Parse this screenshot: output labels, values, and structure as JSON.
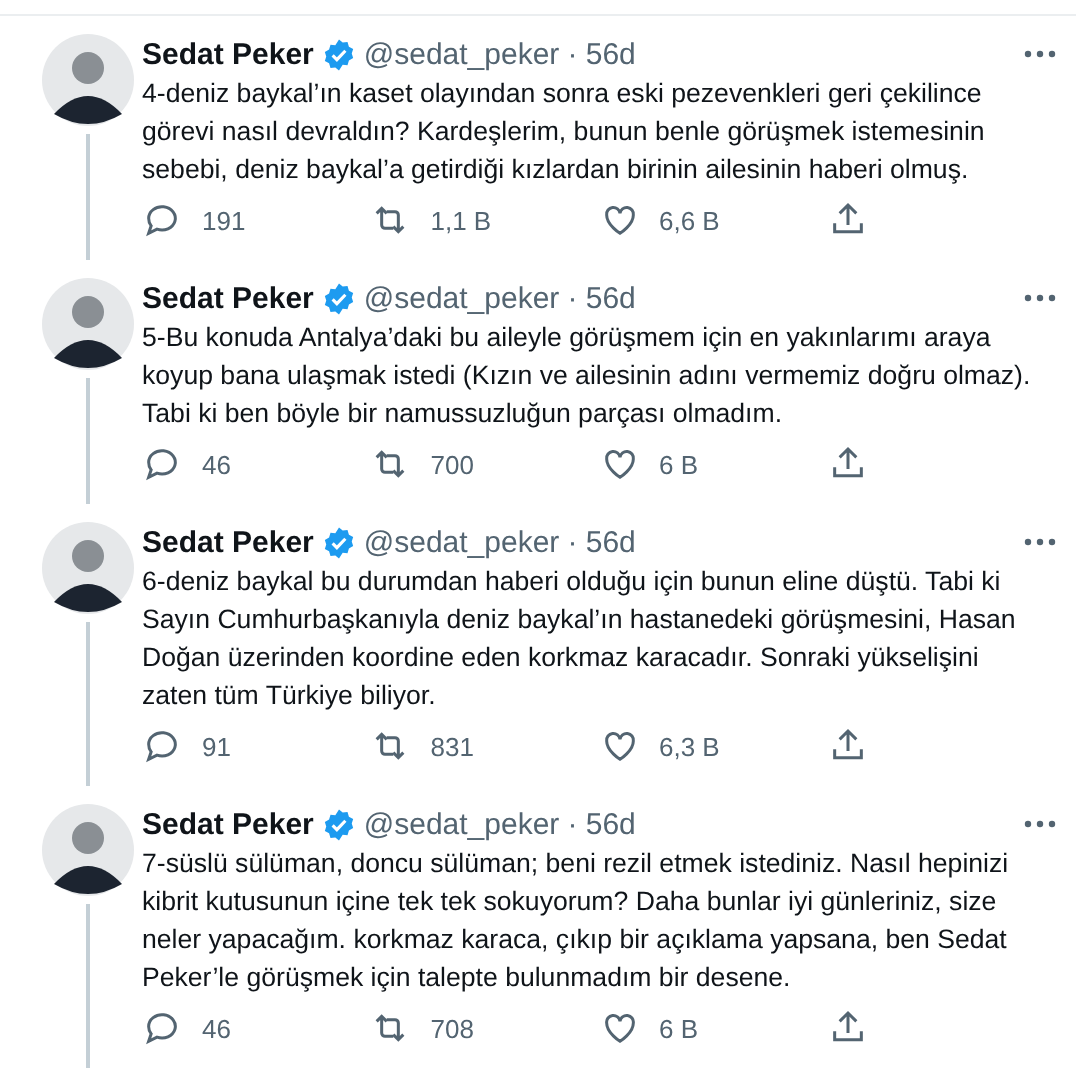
{
  "tweets": [
    {
      "name": "Sedat Peker",
      "handle": "@sedat_peker",
      "time": "· 56d",
      "verified": true,
      "text": "4-deniz baykal’ın kaset olayından sonra eski pezevenkleri geri çekilince görevi nasıl devraldın? Kardeşlerim, bunun benle görüşmek istemesinin sebebi, deniz baykal’a getirdiği kızlardan birinin ailesinin haberi olmuş.",
      "replies": "191",
      "retweets": "1,1 B",
      "likes": "6,6 B"
    },
    {
      "name": "Sedat Peker",
      "handle": "@sedat_peker",
      "time": "· 56d",
      "verified": true,
      "text": "5-Bu konuda Antalya’daki bu aileyle görüşmem için en yakınlarımı araya koyup bana ulaşmak istedi (Kızın ve ailesinin adını vermemiz doğru olmaz). Tabi ki ben böyle bir namussuzluğun parçası olmadım.",
      "replies": "46",
      "retweets": "700",
      "likes": "6 B"
    },
    {
      "name": "Sedat Peker",
      "handle": "@sedat_peker",
      "time": "· 56d",
      "verified": true,
      "text": "6-deniz baykal bu durumdan haberi olduğu için bunun eline düştü. Tabi ki Sayın Cumhurbaşkanıyla deniz baykal’ın hastanedeki görüşmesini, Hasan Doğan üzerinden koordine eden korkmaz karacadır. Sonraki yükselişini zaten tüm Türkiye biliyor.",
      "replies": "91",
      "retweets": "831",
      "likes": "6,3 B"
    },
    {
      "name": "Sedat Peker",
      "handle": "@sedat_peker",
      "time": "· 56d",
      "verified": true,
      "text": "7-süslü sülüman, doncu sülüman; beni rezil etmek istediniz. Nasıl hepinizi kibrit kutusunun içine tek tek sokuyorum? Daha bunlar iyi günleriniz, size neler yapacağım. korkmaz karaca, çıkıp bir açıklama yapsana, ben Sedat Peker’le görüşmek için talepte bulunmadım bir desene.",
      "replies": "46",
      "retweets": "708",
      "likes": "6 B"
    }
  ]
}
